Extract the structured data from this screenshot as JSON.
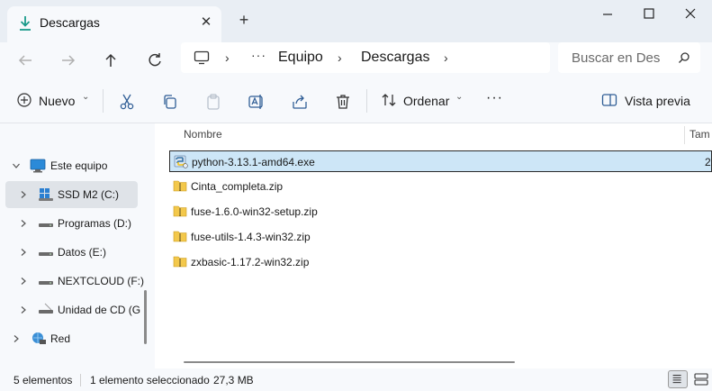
{
  "window": {
    "tab_title": "Descargas",
    "tab_icon": "download-icon",
    "new_tab_label": "+"
  },
  "address": {
    "crumbs": [
      "Equipo",
      "Descargas"
    ],
    "more": "···",
    "search_placeholder": "Buscar en Des"
  },
  "commands": {
    "new_label": "Nuevo",
    "sort_label": "Ordenar",
    "more_label": "···",
    "preview_label": "Vista previa"
  },
  "nav": {
    "items": [
      {
        "label": "Este equipo",
        "icon": "pc-icon"
      },
      {
        "label": "SSD M2 (C:)",
        "icon": "windows-drive-icon"
      },
      {
        "label": "Programas (D:)",
        "icon": "drive-icon"
      },
      {
        "label": "Datos (E:)",
        "icon": "drive-icon"
      },
      {
        "label": "NEXTCLOUD (F:)",
        "icon": "drive-icon"
      },
      {
        "label": "Unidad de CD (G",
        "icon": "cd-drive-icon"
      },
      {
        "label": "Red",
        "icon": "network-icon"
      }
    ]
  },
  "columns": {
    "name": "Nombre",
    "size": "Tam"
  },
  "files": [
    {
      "name": "python-3.13.1-amd64.exe",
      "size": "2",
      "icon": "python-installer-icon",
      "selected": true
    },
    {
      "name": "Cinta_completa.zip",
      "size": "",
      "icon": "zip-folder-icon"
    },
    {
      "name": "fuse-1.6.0-win32-setup.zip",
      "size": "",
      "icon": "zip-folder-icon"
    },
    {
      "name": "fuse-utils-1.4.3-win32.zip",
      "size": "",
      "icon": "zip-folder-icon"
    },
    {
      "name": "zxbasic-1.17.2-win32.zip",
      "size": "",
      "icon": "zip-folder-icon"
    }
  ],
  "status": {
    "count": "5 elementos",
    "selection": "1 elemento seleccionado",
    "size": "27,3 MB"
  },
  "colors": {
    "selection_bg": "#cde6f7",
    "accent": "#2f5d95",
    "folder_zip": "#f3c84b"
  }
}
